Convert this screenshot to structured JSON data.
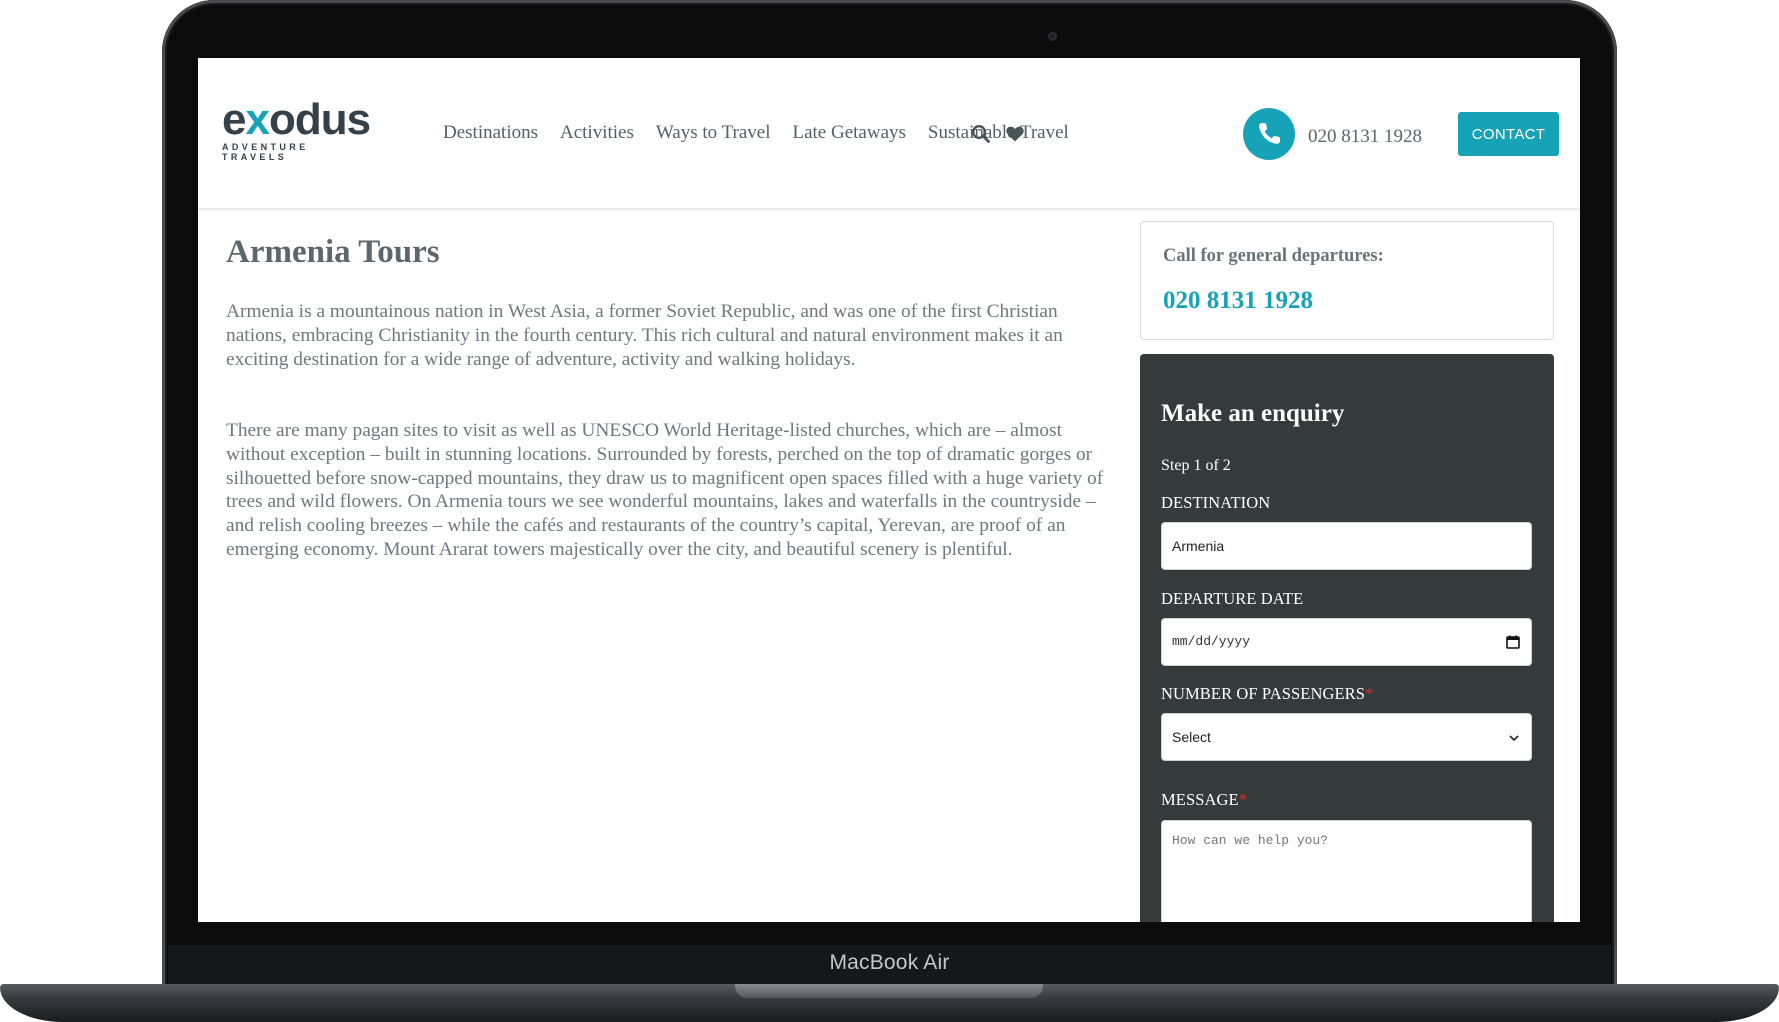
{
  "device": {
    "label": "MacBook Air"
  },
  "header": {
    "logo_word_a": "e",
    "logo_word_x": "x",
    "logo_word_b": "odus",
    "logo_tagline": "ADVENTURE TRAVELS",
    "nav": [
      "Destinations",
      "Activities",
      "Ways to Travel",
      "Late Getaways",
      "Sustainable Travel"
    ],
    "search_icon": "search-icon",
    "wishlist_icon": "heart-icon",
    "phone_icon": "phone-icon",
    "phone": "020 8131 1928",
    "contact_label": "CONTACT"
  },
  "main": {
    "title": "Armenia Tours",
    "paragraphs": [
      "Armenia is a mountainous nation in West Asia, a former Soviet Republic, and was one of the first Christian nations, embracing Christianity in the fourth century. This rich cultural and natural environment makes it an exciting destination for a wide range of adventure, activity and walking holidays.",
      "There are many pagan sites to visit as well as UNESCO World Heritage-listed churches, which are – almost without exception – built in stunning locations. Surrounded by forests, perched on the top of dramatic gorges or silhouetted before snow-capped mountains, they draw us to magnificent open spaces filled with a huge variety of trees and wild flowers. On Armenia tours we see wonderful mountains, lakes and waterfalls in the countryside – and relish cooling breezes – while the cafés and restaurants of the country’s capital, Yerevan, are proof of an emerging economy. Mount Ararat towers majestically over the city, and beautiful scenery is plentiful."
    ]
  },
  "sidebar": {
    "call_label": "Call for general departures:",
    "call_number": "020 8131 1928",
    "enquiry": {
      "title": "Make an enquiry",
      "step": "Step 1 of 2",
      "destination_label": "DESTINATION",
      "destination_value": "Armenia",
      "date_label": "DEPARTURE DATE",
      "date_value": "mm/dd/yyyy",
      "passengers_label": "NUMBER OF PASSENGERS",
      "passengers_value": "Select",
      "message_label": "MESSAGE",
      "message_placeholder": "How can we help you?",
      "required_mark": "*"
    }
  },
  "colors": {
    "accent": "#16a3b7",
    "panel": "#353a3a",
    "text": "#6f787d",
    "required": "#e02a2a"
  }
}
